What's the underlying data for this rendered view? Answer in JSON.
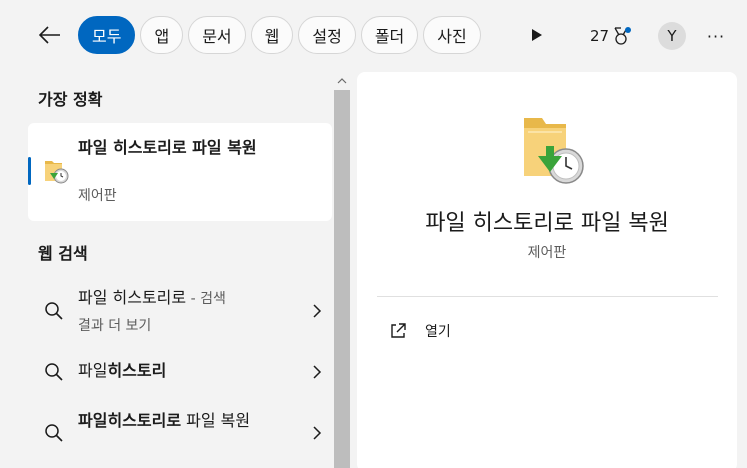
{
  "colors": {
    "accent": "#0067c0",
    "panel": "#ffffff",
    "background": "#f3f3f3"
  },
  "header": {
    "back_icon": "back-arrow-icon",
    "filters": [
      "모두",
      "앱",
      "문서",
      "웹",
      "설정",
      "폴더",
      "사진"
    ],
    "active_filter": "모두",
    "more_filters_icon": "play-icon",
    "points": "27",
    "points_icon": "medal-icon",
    "avatar_initial": "Y",
    "more_icon": "more-options-icon",
    "more_glyph": "···"
  },
  "best_match": {
    "heading": "가장 정확",
    "title": "파일 히스토리로 파일 복원",
    "subtitle": "제어판",
    "icon": "file-history-folder-icon"
  },
  "web_search": {
    "heading": "웹 검색",
    "items": [
      {
        "title": "파일 히스토리로",
        "suffix": " - 검색",
        "subtitle": "결과 더 보기"
      },
      {
        "title_normal": "파일",
        "title_bold": "히스토리"
      },
      {
        "title_bold": "파일히스토리로",
        "title_normal": " 파일 복원"
      }
    ]
  },
  "detail": {
    "title": "파일 히스토리로 파일 복원",
    "subtitle": "제어판",
    "actions": [
      {
        "label": "열기",
        "icon": "open-external-icon"
      }
    ]
  }
}
